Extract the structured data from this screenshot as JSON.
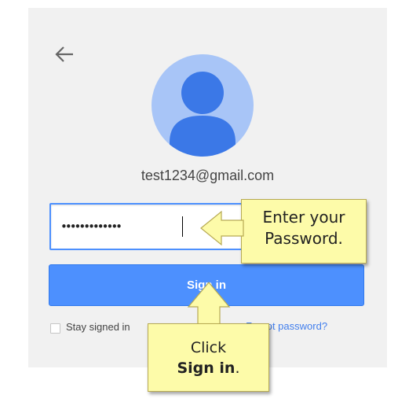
{
  "account": {
    "email": "test1234@gmail.com",
    "password_mask": "•••••••••••••"
  },
  "form": {
    "sign_in_label": "Sign in",
    "stay_signed_in_label": "Stay signed in",
    "forgot_password_label": "Forgot password?"
  },
  "callouts": {
    "password_line1": "Enter your",
    "password_line2": "Password.",
    "signin_line1": "Click",
    "signin_bold": "Sign in",
    "signin_suffix": "."
  },
  "icons": {
    "back": "arrow-left-icon",
    "avatar": "user-silhouette-icon"
  },
  "colors": {
    "primary_blue": "#4d90fe",
    "avatar_bg": "#a8c5f7",
    "avatar_figure": "#3b78e7",
    "callout_yellow": "#fdfba9",
    "link_blue": "#427fed",
    "card_bg": "#f1f1f1"
  }
}
